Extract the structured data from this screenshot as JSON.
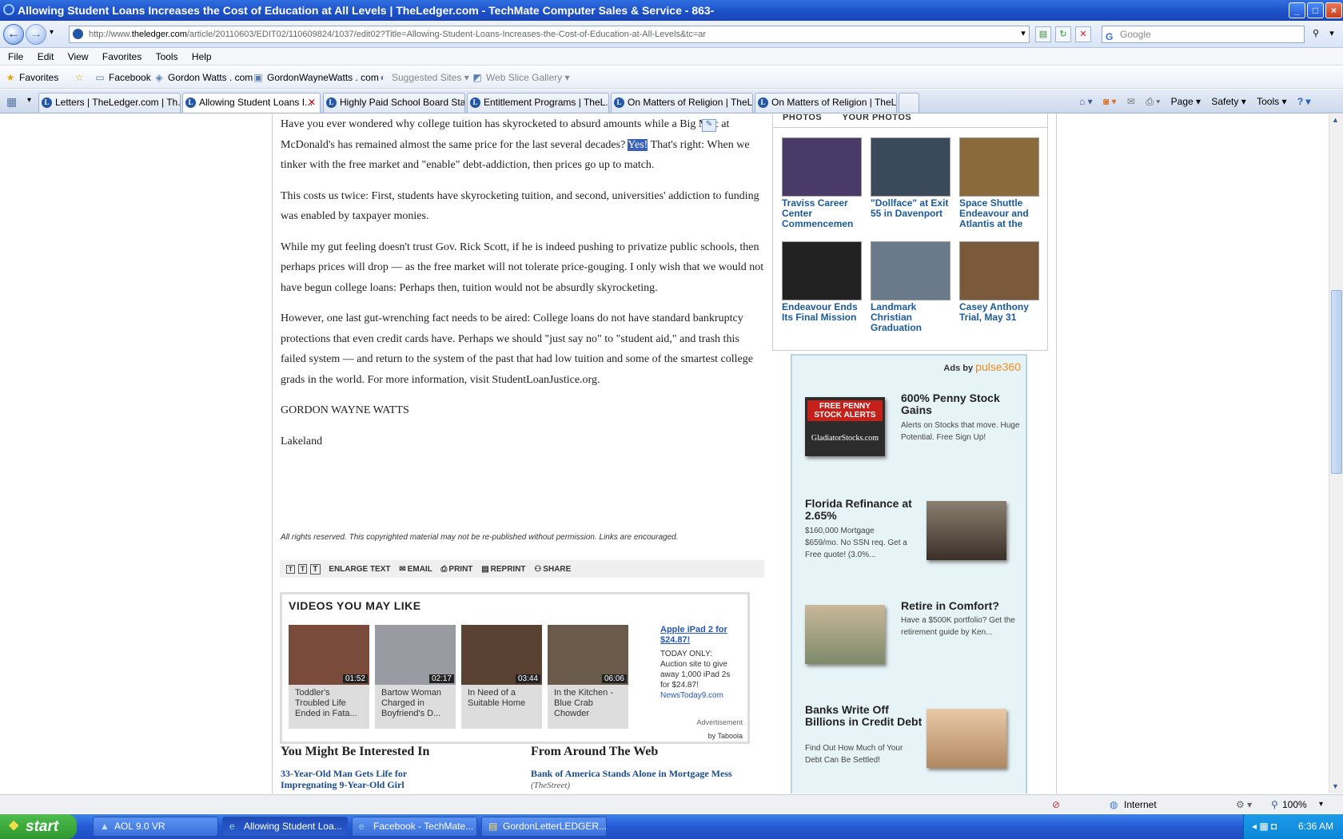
{
  "window": {
    "title": "Allowing Student Loans Increases the Cost of Education at All Levels | TheLedger.com - TechMate Computer Sales & Service - 863-",
    "min_glyph": "_",
    "max_glyph": "□",
    "close_glyph": "×"
  },
  "address": {
    "url_prefix": "http://www.",
    "url_domain": "theledger.com",
    "url_rest": "/article/20110603/EDIT02/110609824/1037/edit02?Title=Allowing-Student-Loans-Increases-the-Cost-of-Education-at-All-Levels&tc=ar",
    "search_placeholder": "Google"
  },
  "menu": [
    "File",
    "Edit",
    "View",
    "Favorites",
    "Tools",
    "Help"
  ],
  "favorites": {
    "label": "Favorites",
    "items": [
      "Facebook",
      "Gordon Watts . com",
      "GordonWayneWatts . com",
      "Suggested Sites ▾",
      "Web Slice Gallery ▾"
    ]
  },
  "tabs": [
    {
      "label": "Letters | TheLedger.com | Th..."
    },
    {
      "label": "Allowing Student Loans I..."
    },
    {
      "label": "Highly Paid School Board Staf..."
    },
    {
      "label": "Entitlement Programs | TheL..."
    },
    {
      "label": "On Matters of Religion | TheL..."
    },
    {
      "label": "On Matters of Religion | TheL..."
    }
  ],
  "commands": [
    "Page ▾",
    "Safety ▾",
    "Tools ▾"
  ],
  "article": {
    "p1_a": "Have you ever wondered why college tuition has skyrocketed to absurd amounts while a Big Mac at McDonald's has remained almost the same price for the last several decades?",
    "p1_highlight": "Yes!",
    "p1_b": "That's right: When we tinker with the free market and \"enable\" debt-addiction, then prices go up to match.",
    "p2": "This costs us twice: First, students have skyrocketing tuition, and second, universities' addiction to funding was enabled by taxpayer monies.",
    "p3": "While my gut feeling doesn't trust Gov. Rick Scott, if he is indeed pushing to privatize public schools, then perhaps prices will drop — as the free market will not tolerate price-gouging. I only wish that we would not have begun college loans: Perhaps then, tuition would not be absurdly skyrocketing.",
    "p4": "However, one last gut-wrenching fact needs to be aired: College loans do not have standard bankruptcy protections that even credit cards have. Perhaps we should \"just say no\" to \"student aid,\" and trash this failed system — and return to the system of the past that had low tuition and some of the smartest college grads in the world. For more information, visit StudentLoanJustice.org.",
    "author": "GORDON WAYNE WATTS",
    "city": "Lakeland",
    "rights": "All rights reserved. This copyrighted material may not be re-published without permission. Links are encouraged."
  },
  "article_tools": [
    "ENLARGE TEXT",
    "EMAIL",
    "PRINT",
    "REPRINT",
    "SHARE"
  ],
  "videos": {
    "heading": "VIDEOS YOU MAY LIKE",
    "items": [
      {
        "title": "Toddler's Troubled Life Ended in Fata...",
        "duration": "01:52",
        "color": "#7a4a3a"
      },
      {
        "title": "Bartow Woman Charged in Boyfriend's D...",
        "duration": "02:17",
        "color": "#9a9aa2"
      },
      {
        "title": "In Need of a Suitable Home",
        "duration": "03:44",
        "color": "#5a4232"
      },
      {
        "title": "In the Kitchen - Blue Crab Chowder",
        "duration": "06:06",
        "color": "#6a5a4a"
      }
    ],
    "ad_link": "Apple iPad 2 for $24.87!",
    "ad_text": "TODAY ONLY: Auction site to give away 1,000 iPad 2s for $24.87!",
    "ad_source": "NewsToday9.com",
    "advertisement": "Advertisement",
    "by": "by Taboola"
  },
  "interest": {
    "left_heading": "You Might Be Interested In",
    "left_link": "33-Year-Old Man Gets Life for Impregnating 9-Year-Old Girl",
    "right_heading": "From Around The Web",
    "right_link": "Bank of America Stands Alone in Mortgage Mess",
    "right_source": "(TheStreet)"
  },
  "photos": {
    "tabs": [
      "PHOTOS",
      "YOUR PHOTOS"
    ],
    "items": [
      {
        "caption": "Traviss Career Center Commencemen",
        "color": "#4a3a6a"
      },
      {
        "caption": "\"Dollface\" at Exit 55 in Davenport",
        "color": "#3a4a5a"
      },
      {
        "caption": "Space Shuttle Endeavour and Atlantis at the",
        "color": "#8a6a3a"
      },
      {
        "caption": "Endeavour Ends Its Final Mission",
        "color": "#222222"
      },
      {
        "caption": "Landmark Christian Graduation",
        "color": "#6a7a8a"
      },
      {
        "caption": "Casey Anthony Trial, May 31",
        "color": "#7a5a3a"
      }
    ]
  },
  "ads": {
    "ads_by": "Ads by",
    "brand": "pulse360",
    "items": [
      {
        "title": "600% Penny Stock Gains",
        "text": "Alerts on Stocks that move. Huge Potential. Free Sign Up!",
        "img_line1": "FREE PENNY STOCK ALERTS",
        "img_line2": "GladiatorStocks.com"
      },
      {
        "title": "Florida Refinance at 2.65%",
        "text": "$160,000 Mortgage $659/mo. No SSN req. Get a Free quote! (3.0%..."
      },
      {
        "title": "Retire in Comfort?",
        "text": "Have a $500K portfolio? Get the retirement guide by Ken..."
      },
      {
        "title": "Banks Write Off Billions in Credit Debt",
        "text": "Find Out How Much of Your Debt Can Be Settled!"
      }
    ]
  },
  "status": {
    "zone": "Internet",
    "zoom": "100%"
  },
  "taskbar": {
    "start": "start",
    "items": [
      "AOL 9.0 VR",
      "Allowing Student Loa...",
      "Facebook - TechMate...",
      "GordonLetterLEDGER..."
    ],
    "time": "6:36 AM"
  }
}
